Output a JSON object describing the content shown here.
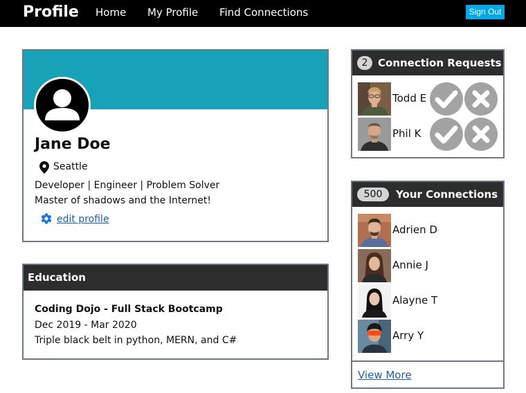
{
  "navbar": {
    "brand": "Profile",
    "links": [
      "Home",
      "My Profile",
      "Find Connections"
    ],
    "sign_out": "Sign Out",
    "background": "#000000",
    "sign_out_color": "#00a8e8"
  },
  "profile": {
    "banner_color": "#17a2b8",
    "name": "Jane Doe",
    "location": "Seattle",
    "tagline": "Developer | Engineer | Problem Solver",
    "bio": "Master of shadows and the Internet!",
    "edit_label": "edit profile",
    "icons": {
      "avatar": "default-user-icon",
      "location": "map-pin-icon",
      "edit": "gear-icon"
    }
  },
  "education": {
    "header": "Education",
    "school": "Coding Dojo - Full Stack Bootcamp",
    "dates": "Dec 2019 - Mar 2020",
    "description": "Triple black belt in python, MERN, and C#"
  },
  "requests": {
    "count": "2",
    "title": "Connection Requests",
    "people": [
      {
        "name": "Todd E"
      },
      {
        "name": "Phil K"
      }
    ],
    "icons": {
      "accept": "check-icon",
      "reject": "x-icon"
    }
  },
  "connections": {
    "count": "500",
    "title": "Your Connections",
    "people": [
      {
        "name": "Adrien D"
      },
      {
        "name": "Annie J"
      },
      {
        "name": "Alayne T"
      },
      {
        "name": "Arry Y"
      }
    ],
    "view_more": "View More"
  }
}
